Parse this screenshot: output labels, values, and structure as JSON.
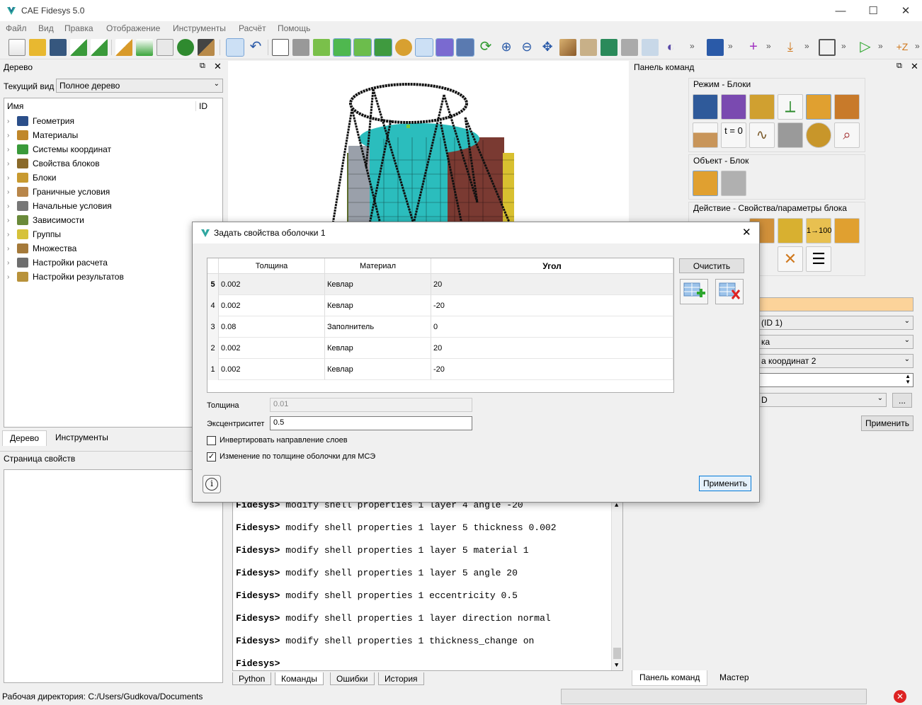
{
  "window": {
    "title": "CAE Fidesys 5.0"
  },
  "menu": [
    "Файл",
    "Вид",
    "Правка",
    "Отображение",
    "Инструменты",
    "Расчёт",
    "Помощь"
  ],
  "toolbar": {
    "chevron": "»"
  },
  "tree_panel": {
    "title": "Дерево",
    "current_view_label": "Текущий вид",
    "current_view_value": "Полное дерево",
    "col_name": "Имя",
    "col_id": "ID",
    "items": [
      {
        "label": "Геометрия",
        "color": "#2b4f8a"
      },
      {
        "label": "Материалы",
        "color": "#c0872a"
      },
      {
        "label": "Системы координат",
        "color": "#3a9a3a"
      },
      {
        "label": "Свойства блоков",
        "color": "#8a6a2a"
      },
      {
        "label": "Блоки",
        "color": "#c89a30"
      },
      {
        "label": "Граничные условия",
        "color": "#b8864a"
      },
      {
        "label": "Начальные условия",
        "color": "#777777"
      },
      {
        "label": "Зависимости",
        "color": "#6a8a3a"
      },
      {
        "label": "Группы",
        "color": "#d6c23a"
      },
      {
        "label": "Множества",
        "color": "#a57a3a"
      },
      {
        "label": "Настройки расчета",
        "color": "#6e6e6e"
      },
      {
        "label": "Настройки результатов",
        "color": "#b8923a"
      }
    ],
    "tabs": [
      "Дерево",
      "Инструменты"
    ]
  },
  "props_panel": {
    "title": "Страница свойств"
  },
  "cmd_panel": {
    "title": "Панель команд",
    "mode_group": "Режим - Блоки",
    "object_group": "Объект - Блок",
    "action_group": "Действие - Свойства/параметры блока",
    "t0_label": "t = 0",
    "fields": [
      "(ID 1)",
      "ка",
      "а координат 2",
      "",
      "D"
    ],
    "ellipsis": "...",
    "apply": "Применить",
    "tabs": [
      "Панель команд",
      "Мастер"
    ]
  },
  "dialog": {
    "title": "Задать свойства оболочки 1",
    "columns": [
      "Толщина",
      "Материал",
      "Угол"
    ],
    "rows": [
      {
        "n": "5",
        "thickness": "0.002",
        "material": "Кевлар",
        "angle": "20"
      },
      {
        "n": "4",
        "thickness": "0.002",
        "material": "Кевлар",
        "angle": "-20"
      },
      {
        "n": "3",
        "thickness": "0.08",
        "material": "Заполнитель",
        "angle": "0"
      },
      {
        "n": "2",
        "thickness": "0.002",
        "material": "Кевлар",
        "angle": "20"
      },
      {
        "n": "1",
        "thickness": "0.002",
        "material": "Кевлар",
        "angle": "-20"
      }
    ],
    "clear": "Очистить",
    "thickness_label": "Толщина",
    "thickness_value": "0.01",
    "eccentricity_label": "Эксцентриситет",
    "eccentricity_value": "0.5",
    "invert_label": "Инвертировать направление слоев",
    "invert_checked": false,
    "thickness_change_label": "Изменение по толщине оболочки для МСЭ",
    "thickness_change_checked": true,
    "apply": "Применить",
    "info": "i"
  },
  "console": {
    "prompt": "Fidesys>",
    "lines": [
      "modify shell properties 1 layer 4 angle -20",
      "modify shell properties 1 layer 5 thickness 0.002",
      "modify shell properties 1 layer 5 material 1",
      "modify shell properties 1 layer 5 angle 20",
      "modify shell properties 1 eccentricity 0.5",
      "modify shell properties 1 layer direction normal",
      "modify shell properties 1 thickness_change on",
      ""
    ],
    "tabs": [
      "Python",
      "Команды",
      "Ошибки",
      "История"
    ]
  },
  "status": {
    "workdir": "Рабочая директория: C:/Users/Gudkova/Documents"
  }
}
